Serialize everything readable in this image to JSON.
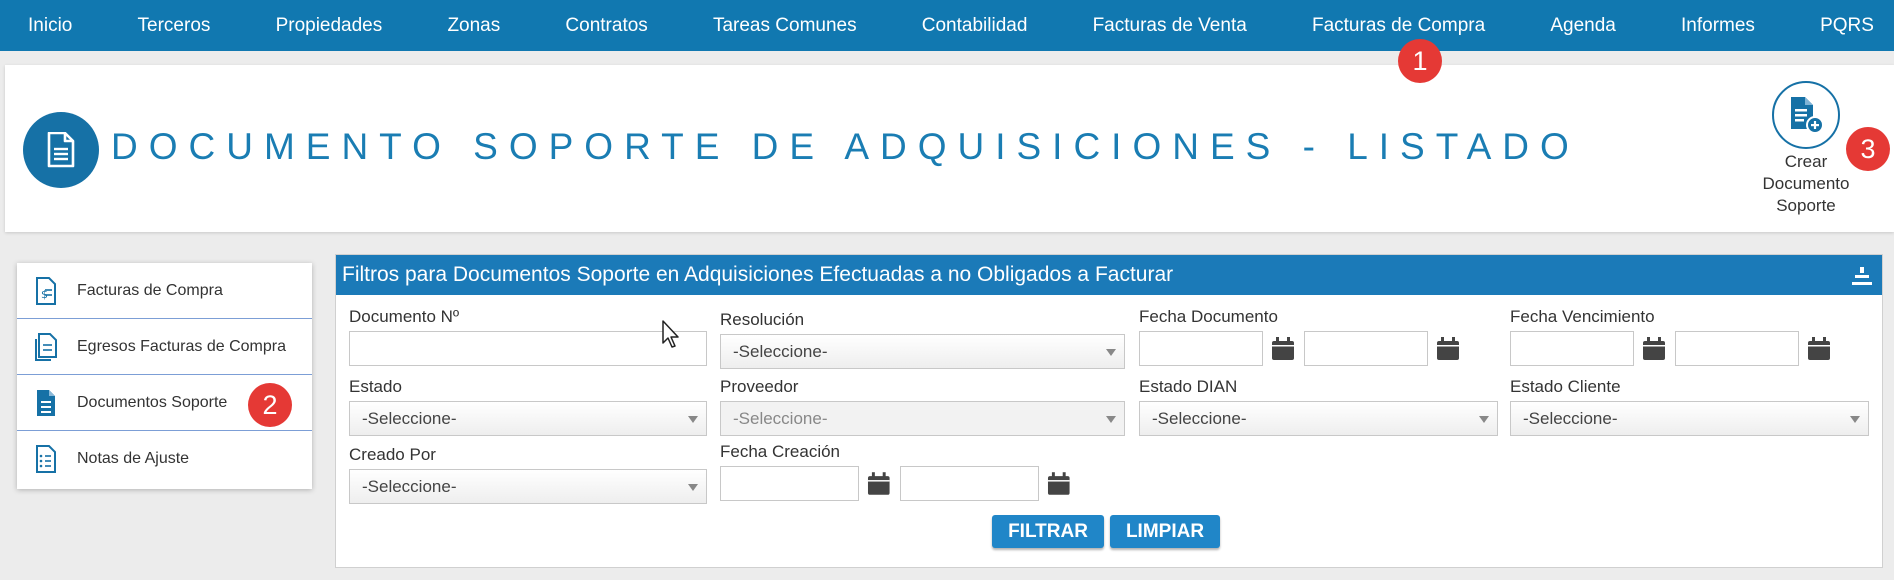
{
  "nav": {
    "items": [
      "Inicio",
      "Terceros",
      "Propiedades",
      "Zonas",
      "Contratos",
      "Tareas Comunes",
      "Contabilidad",
      "Facturas de Venta",
      "Facturas de Compra",
      "Agenda",
      "Informes",
      "PQRS"
    ]
  },
  "badges": {
    "b1": "1",
    "b2": "2",
    "b3": "3"
  },
  "header": {
    "title": "DOCUMENTO SOPORTE DE ADQUISICIONES - LISTADO",
    "create_label_1": "Crear",
    "create_label_2": "Documento",
    "create_label_3": "Soporte",
    "icon": "document-icon",
    "create_icon": "document-add-icon"
  },
  "sidebar": {
    "items": [
      {
        "label": "Facturas de Compra",
        "icon": "invoice-icon"
      },
      {
        "label": "Egresos Facturas de Compra",
        "icon": "invoice-transfer-icon"
      },
      {
        "label": "Documentos Soporte",
        "icon": "document-icon"
      },
      {
        "label": "Notas de Ajuste",
        "icon": "notes-icon"
      }
    ]
  },
  "filters": {
    "title": "Filtros para Documentos Soporte en Adquisiciones Efectuadas a no Obligados a Facturar",
    "documento_label": "Documento Nº",
    "documento_value": "",
    "resolucion_label": "Resolución",
    "resolucion_value": "-Seleccione-",
    "fecha_documento_label": "Fecha Documento",
    "fecha_vencimiento_label": "Fecha Vencimiento",
    "estado_label": "Estado",
    "estado_value": "-Seleccione-",
    "proveedor_label": "Proveedor",
    "proveedor_value": "-Seleccione-",
    "estado_dian_label": "Estado DIAN",
    "estado_dian_value": "-Seleccione-",
    "estado_cliente_label": "Estado Cliente",
    "estado_cliente_value": "-Seleccione-",
    "creado_por_label": "Creado Por",
    "creado_por_value": "-Seleccione-",
    "fecha_creacion_label": "Fecha Creación",
    "filtrar_label": "FILTRAR",
    "limpiar_label": "LIMPIAR"
  },
  "colors": {
    "brand": "#1178b0",
    "panel_header": "#1b7ab8",
    "badge": "#e53935",
    "button": "#2086c8"
  }
}
